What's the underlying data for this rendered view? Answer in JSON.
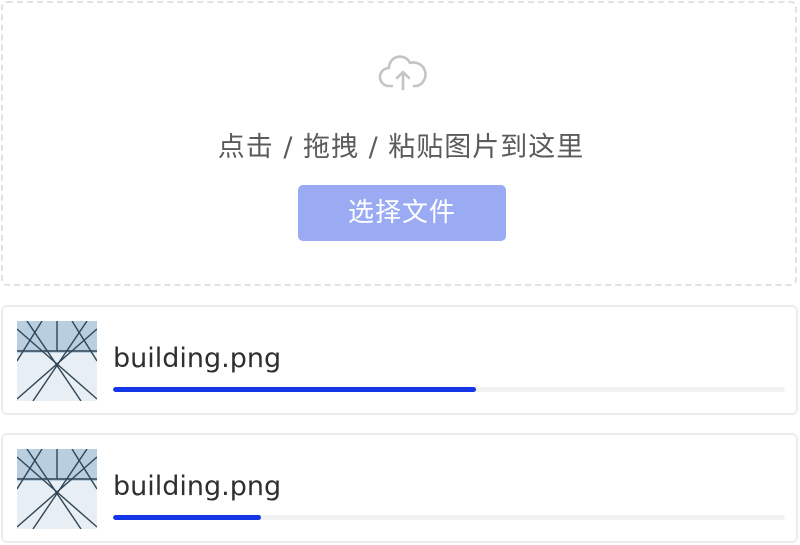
{
  "dropzone": {
    "icon": "cloud-upload-icon",
    "hint_text": "点击 / 拖拽 / 粘贴图片到这里",
    "select_button_label": "选择文件"
  },
  "colors": {
    "accent": "#1536e6",
    "button": "#9aabf4",
    "border": "#e2e2e2",
    "track": "#f1f1f1"
  },
  "files": [
    {
      "name": "building.png",
      "progress": 0.54,
      "thumbnail_icon": "building-image-icon"
    },
    {
      "name": "building.png",
      "progress": 0.22,
      "thumbnail_icon": "building-image-icon"
    }
  ]
}
